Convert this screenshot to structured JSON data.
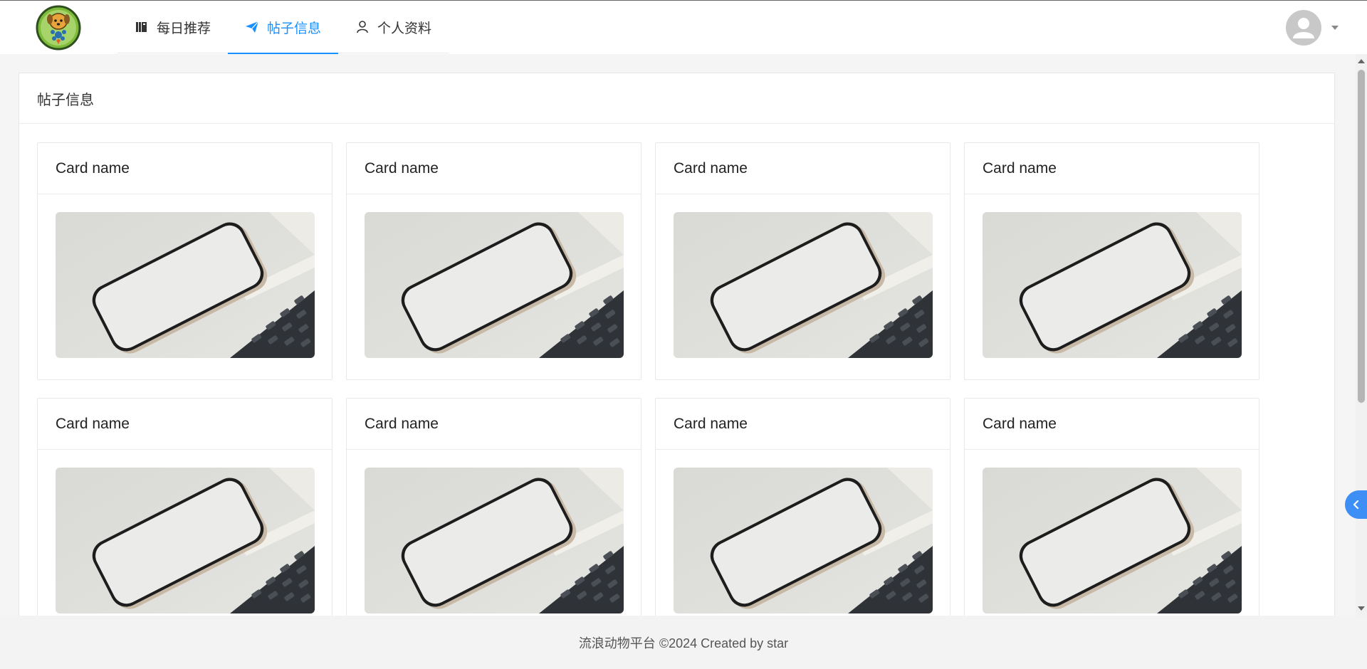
{
  "header": {
    "logo_label": "",
    "nav": [
      {
        "label": "每日推荐",
        "icon": "book-icon",
        "active": false
      },
      {
        "label": "帖子信息",
        "icon": "send-icon",
        "active": true
      },
      {
        "label": "个人资料",
        "icon": "user-icon",
        "active": false
      }
    ],
    "avatar_icon": "user-avatar-icon",
    "dropdown_icon": "caret-down-icon"
  },
  "panel": {
    "title": "帖子信息"
  },
  "cards": [
    {
      "title": "Card name"
    },
    {
      "title": "Card name"
    },
    {
      "title": "Card name"
    },
    {
      "title": "Card name"
    },
    {
      "title": "Card name"
    },
    {
      "title": "Card name"
    },
    {
      "title": "Card name"
    },
    {
      "title": "Card name"
    }
  ],
  "footer": {
    "text": "流浪动物平台 ©2024 Created by star"
  },
  "colors": {
    "accent": "#1890ff",
    "side_toggle": "#3d8ef5"
  }
}
